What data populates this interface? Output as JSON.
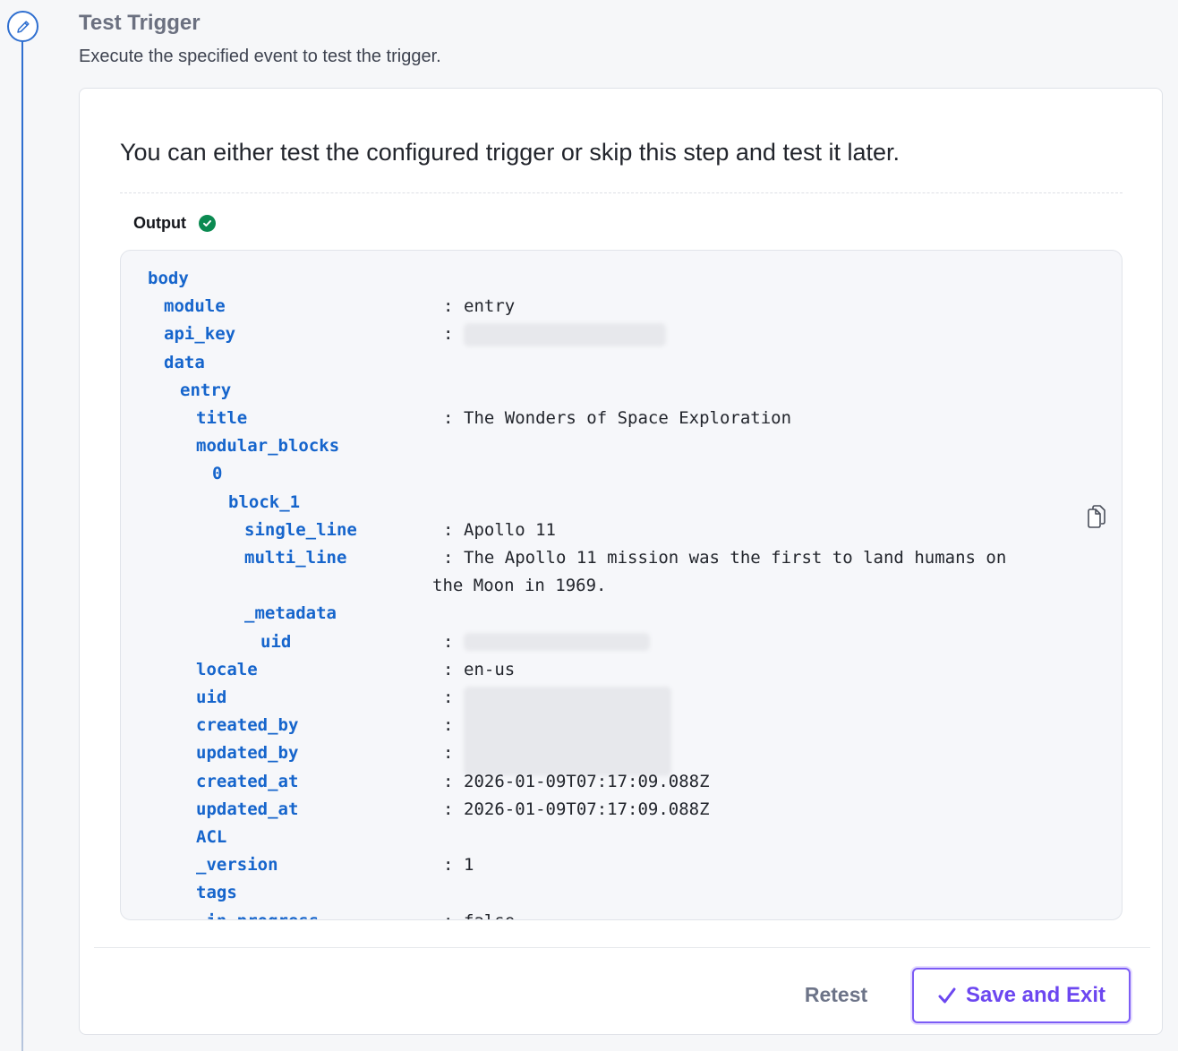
{
  "step": {
    "title": "Test Trigger",
    "description": "Execute the specified event to test the trigger.",
    "icon": "pencil-icon"
  },
  "card": {
    "intro": "You can either test the configured trigger or skip this step and test it later.",
    "output_label": "Output",
    "output_status": "success"
  },
  "code": {
    "lines": [
      {
        "key": "body",
        "indent": 0,
        "value": null
      },
      {
        "key": "module",
        "indent": 1,
        "value": "entry"
      },
      {
        "key": "api_key",
        "indent": 1,
        "value": "",
        "redacted": true
      },
      {
        "key": "data",
        "indent": 1,
        "value": null
      },
      {
        "key": "entry",
        "indent": 2,
        "value": null
      },
      {
        "key": "title",
        "indent": 3,
        "value": "The Wonders of Space Exploration"
      },
      {
        "key": "modular_blocks",
        "indent": 3,
        "value": null
      },
      {
        "key": "0",
        "indent": 4,
        "value": null
      },
      {
        "key": "block_1",
        "indent": 5,
        "value": null
      },
      {
        "key": "single_line",
        "indent": 6,
        "value": "Apollo 11"
      },
      {
        "key": "multi_line",
        "indent": 6,
        "value": "The Apollo 11 mission was the first to land humans on",
        "continuation": "the Moon in 1969."
      },
      {
        "key": "_metadata",
        "indent": 6,
        "value": null
      },
      {
        "key": "uid",
        "indent": 7,
        "value": "",
        "redacted": true
      },
      {
        "key": "locale",
        "indent": 3,
        "value": "en-us"
      },
      {
        "key": "uid",
        "indent": 3,
        "value": "",
        "redacted": true
      },
      {
        "key": "created_by",
        "indent": 3,
        "value": "",
        "redacted": true
      },
      {
        "key": "updated_by",
        "indent": 3,
        "value": "",
        "redacted": true
      },
      {
        "key": "created_at",
        "indent": 3,
        "value": "2026-01-09T07:17:09.088Z"
      },
      {
        "key": "updated_at",
        "indent": 3,
        "value": "2026-01-09T07:17:09.088Z"
      },
      {
        "key": "ACL",
        "indent": 3,
        "value": null
      },
      {
        "key": "_version",
        "indent": 3,
        "value": "1"
      },
      {
        "key": "tags",
        "indent": 3,
        "value": null
      },
      {
        "key": "_in_progress",
        "indent": 3,
        "value": "false"
      }
    ]
  },
  "buttons": {
    "retest": "Retest",
    "save_exit": "Save and Exit",
    "save_icon": "checkmark-icon"
  },
  "colors": {
    "accent": "#6c47f0",
    "rail": "#2f6fd0",
    "key": "#1665cc",
    "success": "#0b8a51"
  }
}
